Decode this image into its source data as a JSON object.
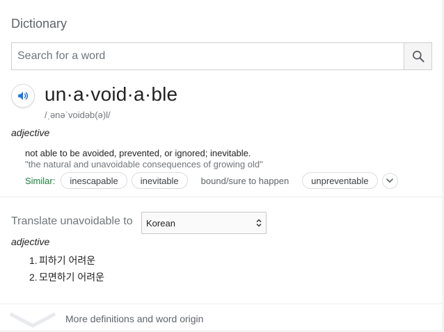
{
  "header": {
    "title": "Dictionary"
  },
  "search": {
    "placeholder": "Search for a word",
    "value": "",
    "icon": "search-icon"
  },
  "entry": {
    "headword": "un·a·void·a·ble",
    "phonetic": "/ˌənəˈvoidəb(ə)l/",
    "audio_icon": "speaker-icon",
    "sense": {
      "part_of_speech": "adjective",
      "definition": "not able to be avoided, prevented, or ignored; inevitable.",
      "example": "\"the natural and unavoidable consequences of growing old\"",
      "similar_label": "Similar:",
      "similar": [
        "inescapable",
        "inevitable",
        "bound/sure to happen",
        "unpreventable"
      ]
    }
  },
  "translate": {
    "label": "Translate unavoidable to",
    "language": "Korean",
    "part_of_speech": "adjective",
    "items": [
      {
        "num": "1.",
        "text": "피하기 어려운"
      },
      {
        "num": "2.",
        "text": "모면하기 어려운"
      }
    ]
  },
  "footer": {
    "more_label": "More definitions and word origin"
  },
  "colors": {
    "accent_blue": "#1a73e8",
    "similar_green": "#188038",
    "muted": "#70757a"
  }
}
